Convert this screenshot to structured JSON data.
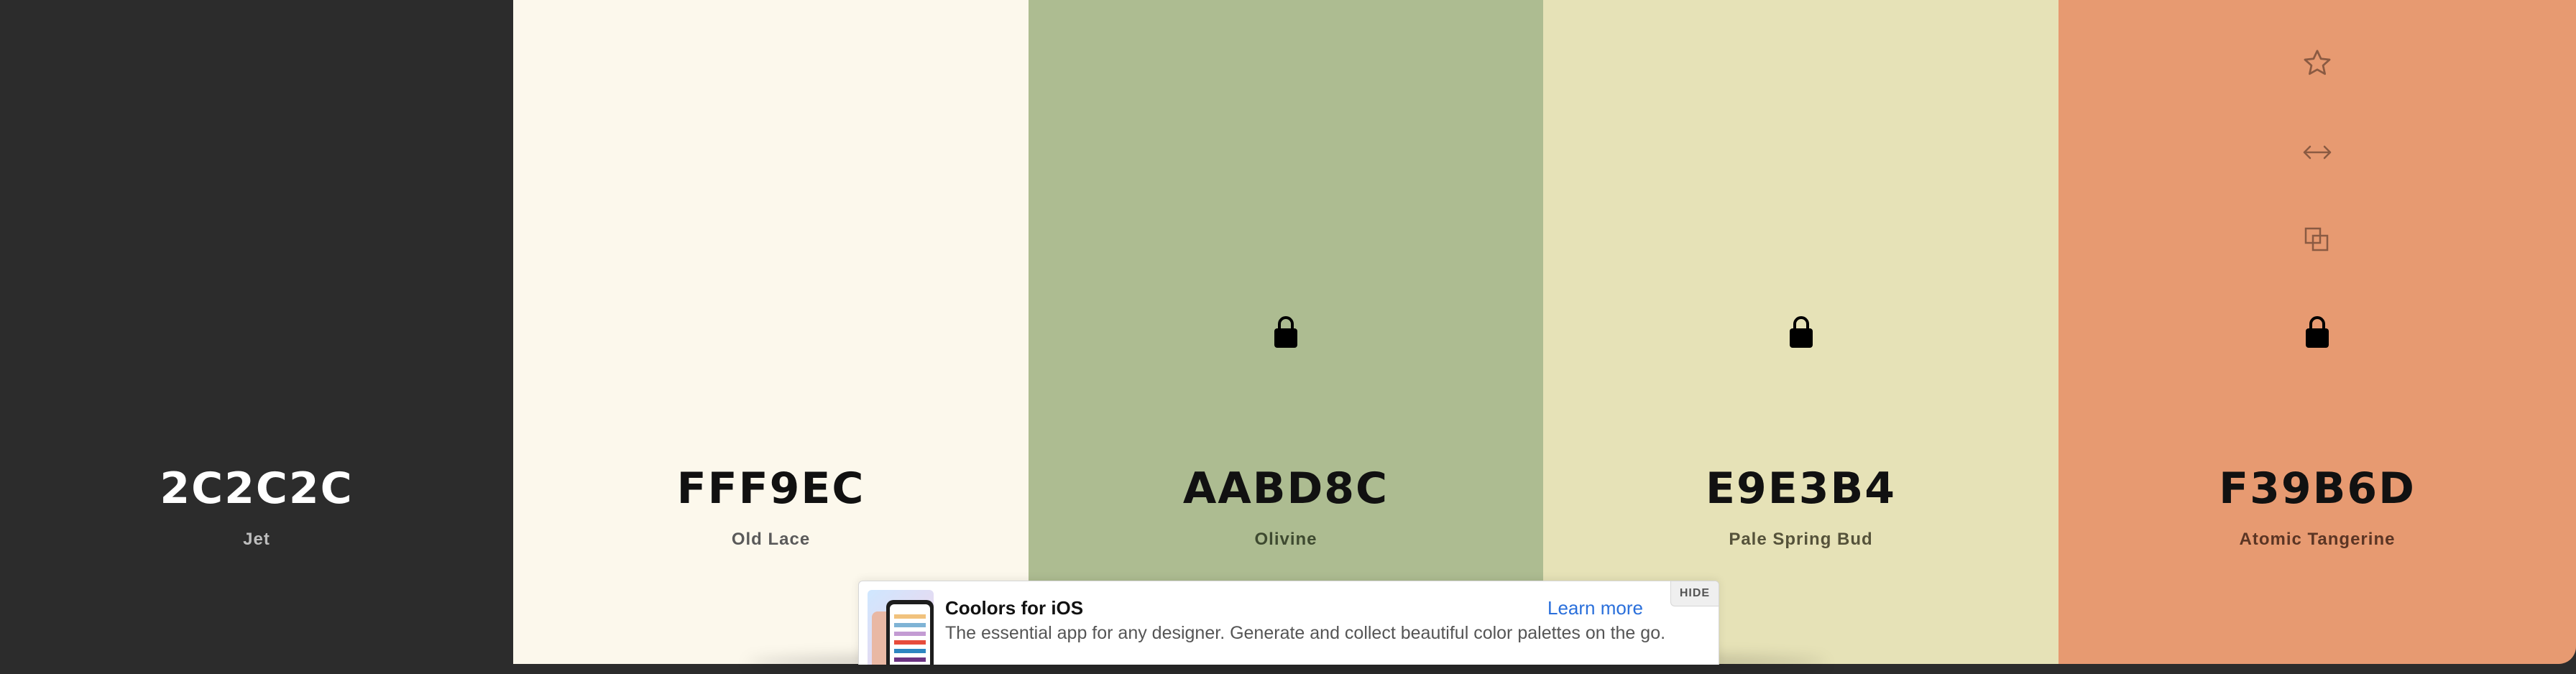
{
  "palette": {
    "colors": [
      {
        "hex": "2C2C2C",
        "name": "Jet",
        "bg": "#2C2C2C",
        "text_color": "#ffffff",
        "name_color": "#bdbdbd",
        "locked": false,
        "hovered": false
      },
      {
        "hex": "FFF9EC",
        "name": "Old Lace",
        "bg": "#FCF8EC",
        "text_color": "#111111",
        "name_color": "#5a5a5a",
        "locked": false,
        "hovered": false
      },
      {
        "hex": "AABD8C",
        "name": "Olivine",
        "bg": "#ADBC91",
        "text_color": "#111111",
        "name_color": "#3e4a30",
        "locked": true,
        "hovered": false
      },
      {
        "hex": "E9E3B4",
        "name": "Pale Spring Bud",
        "bg": "#E6E2B7",
        "text_color": "#111111",
        "name_color": "#55523a",
        "locked": true,
        "hovered": false
      },
      {
        "hex": "F39B6D",
        "name": "Atomic Tangerine",
        "bg": "#E79A71",
        "text_color": "#111111",
        "name_color": "#5b3524",
        "locked": true,
        "hovered": true
      }
    ],
    "tool_icons": [
      "star-icon",
      "drag-arrows-icon",
      "copy-icon",
      "lock-icon"
    ]
  },
  "banner": {
    "title": "Coolors for iOS",
    "description": "The essential app for any designer. Generate and collect beautiful color palettes on the go.",
    "learn_more": "Learn more",
    "hide": "HIDE"
  }
}
